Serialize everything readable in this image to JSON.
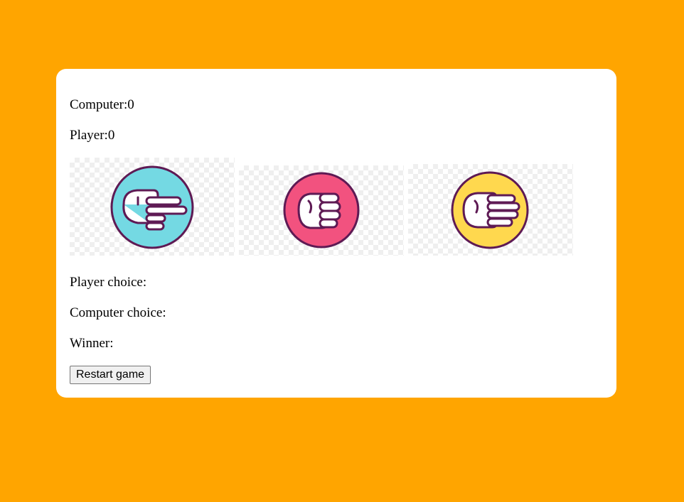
{
  "score": {
    "computer_label": "Computer:",
    "computer_value": "0",
    "player_label": "Player:",
    "player_value": "0"
  },
  "choices": [
    {
      "icon": "scissors-hand-icon",
      "color": "#74d9e3"
    },
    {
      "icon": "rock-fist-icon",
      "color": "#f2527f"
    },
    {
      "icon": "paper-hand-icon",
      "color": "#ffd84e"
    }
  ],
  "result": {
    "player_choice_label": "Player choice:",
    "player_choice_value": "",
    "computer_choice_label": "Computer choice:",
    "computer_choice_value": "",
    "winner_label": "Winner:",
    "winner_value": ""
  },
  "restart_label": "Restart game",
  "colors": {
    "background": "#ffa500",
    "card": "#ffffff",
    "outline": "#5e1a54"
  }
}
